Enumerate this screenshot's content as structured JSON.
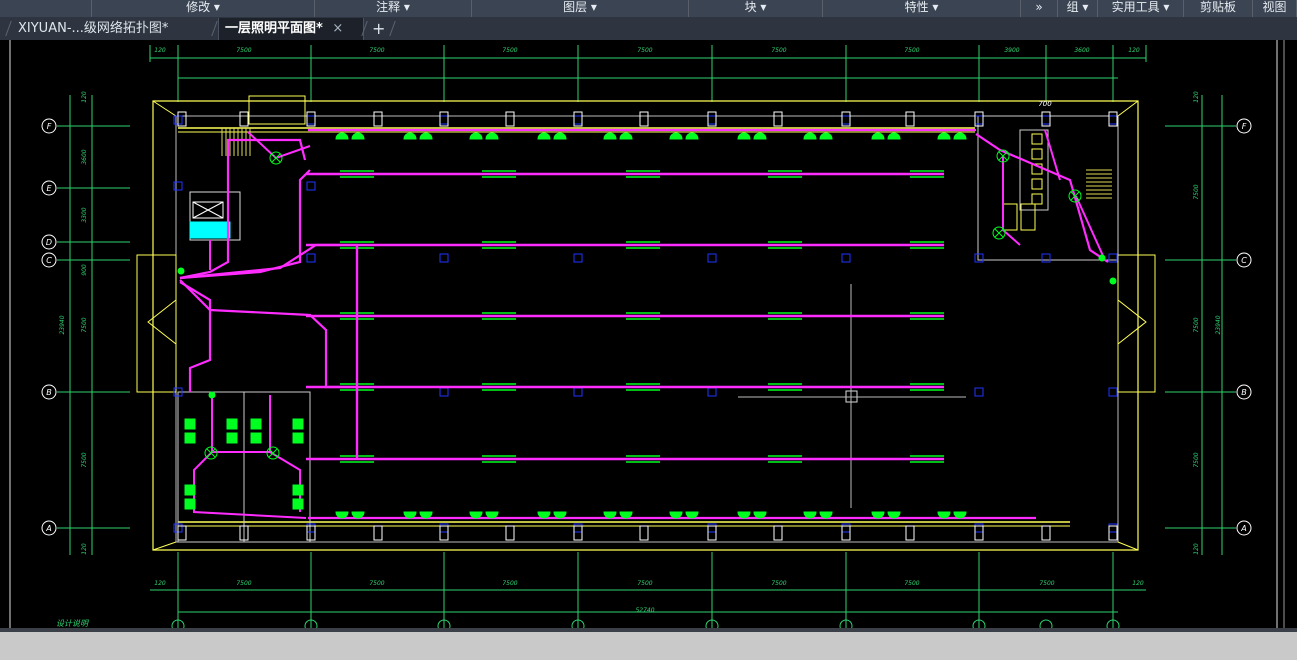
{
  "ribbon": {
    "panels": [
      "",
      "修改 ▾",
      "注释 ▾",
      "图层 ▾",
      "块 ▾",
      "特性 ▾",
      "»",
      "组 ▾",
      "实用工具 ▾",
      "剪贴板",
      "视图"
    ]
  },
  "tabs": [
    {
      "label": "XIYUAN-...级网络拓扑图*",
      "active": false
    },
    {
      "label": "一层照明平面图*",
      "active": true,
      "close": "×"
    }
  ],
  "new_tab_symbol": "+",
  "drawing": {
    "top_dims": [
      "120",
      "7500",
      "7500",
      "7500",
      "7500",
      "7500",
      "7500",
      "3900",
      "3600",
      "120"
    ],
    "bottom_dims": [
      "120",
      "7500",
      "7500",
      "7500",
      "7500",
      "7500",
      "7500",
      "7500",
      "120"
    ],
    "total_width_dim": "52740",
    "left_dims": [
      "120",
      "3600",
      "3300",
      "900",
      "7500",
      "23940",
      "7500",
      "120"
    ],
    "right_dims": [
      "120",
      "7500",
      "7500",
      "23940",
      "7500",
      "120"
    ],
    "grid_axes": [
      "F",
      "E",
      "D",
      "C",
      "B",
      "A"
    ],
    "door_dim": "700",
    "corner_note": "设计说明"
  },
  "colors": {
    "wiring": "#ff2cff",
    "fixtures": "#00ff20",
    "walls": "#ffff55",
    "dimensions": "#2ed36f",
    "columns": "#1f33ff",
    "equipment": "#00ffff",
    "background": "#000000"
  }
}
